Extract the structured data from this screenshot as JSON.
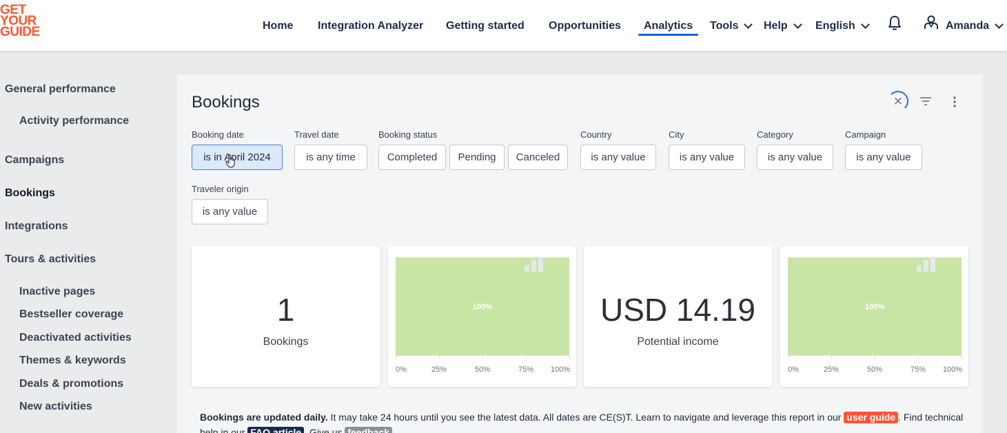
{
  "brand": {
    "logo_lines": [
      "GET",
      "YOUR",
      "GUIDE"
    ],
    "accent": "#ff5533",
    "primary": "#1a2b49"
  },
  "nav": {
    "items": [
      {
        "label": "Home"
      },
      {
        "label": "Integration Analyzer"
      },
      {
        "label": "Getting started"
      },
      {
        "label": "Opportunities"
      },
      {
        "label": "Analytics",
        "active": true
      },
      {
        "label": "Tools",
        "dropdown": true
      },
      {
        "label": "Help",
        "dropdown": true
      },
      {
        "label": "English",
        "dropdown": true
      }
    ],
    "notifications_icon": "bell-icon",
    "user": {
      "name": "Amanda",
      "icon": "user-icon"
    }
  },
  "sidebar": {
    "items": [
      {
        "label": "General performance"
      },
      {
        "label": "Activity performance",
        "sub": true
      },
      {
        "label": "Campaigns"
      },
      {
        "label": "Bookings",
        "active": true
      },
      {
        "label": "Integrations"
      },
      {
        "label": "Tours & activities"
      },
      {
        "label": "Inactive pages",
        "sub": true
      },
      {
        "label": "Bestseller coverage",
        "sub": true
      },
      {
        "label": "Deactivated activities",
        "sub": true
      },
      {
        "label": "Themes & keywords",
        "sub": true
      },
      {
        "label": "Deals & promotions",
        "sub": true
      },
      {
        "label": "New activities",
        "sub": true
      }
    ]
  },
  "main": {
    "title": "Bookings",
    "filters": {
      "booking_date": {
        "label": "Booking date",
        "value": "is in April 2024"
      },
      "travel_date": {
        "label": "Travel date",
        "value": "is any time"
      },
      "booking_status": {
        "label": "Booking status",
        "options": [
          "Completed",
          "Pending",
          "Canceled"
        ]
      },
      "country": {
        "label": "Country",
        "value": "is any value"
      },
      "city": {
        "label": "City",
        "value": "is any value"
      },
      "category": {
        "label": "Category",
        "value": "is any value"
      },
      "campaign": {
        "label": "Campaign",
        "value": "is any value"
      },
      "traveler_origin": {
        "label": "Traveler origin",
        "value": "is any value"
      }
    },
    "kpis": [
      {
        "value": "1",
        "label": "Bookings"
      },
      {
        "value": "USD 14.19",
        "label": "Potential income"
      }
    ],
    "note": {
      "bold": "Bookings are updated daily.",
      "text1": " It may take 24 hours until you see the latest data. All dates are CE(S)T. Learn to navigate and leverage this report in our ",
      "user_guide": "user guide",
      "text2": ". Find technical help in our ",
      "faq": "FAQ article",
      "text3": ". Give us ",
      "feedback": "feedback"
    }
  },
  "chart_data": [
    {
      "type": "bar",
      "orientation": "horizontal",
      "values": [
        100
      ],
      "data_label": "100%",
      "xticks": [
        "0%",
        "25%",
        "50%",
        "75%",
        "100%"
      ],
      "xlim": [
        0,
        100
      ],
      "color": "#c9e5a5"
    },
    {
      "type": "bar",
      "orientation": "horizontal",
      "values": [
        100
      ],
      "data_label": "100%",
      "xticks": [
        "0%",
        "25%",
        "50%",
        "75%",
        "100%"
      ],
      "xlim": [
        0,
        100
      ],
      "color": "#c9e5a5"
    }
  ]
}
